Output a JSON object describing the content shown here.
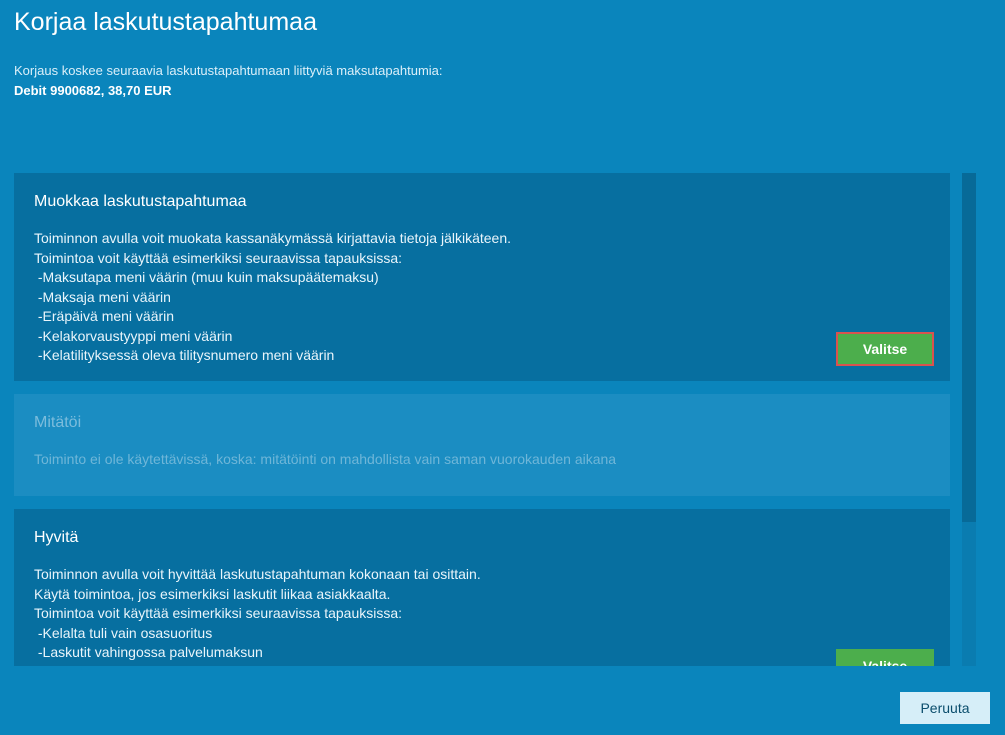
{
  "page": {
    "title": "Korjaa laskutustapahtumaa",
    "intro": "Korjaus koskee seuraavia laskutustapahtumaan liittyviä maksutapahtumia:",
    "debit": "Debit 9900682, 38,70 EUR"
  },
  "cards": [
    {
      "title": "Muokkaa laskutustapahtumaa",
      "lines": [
        "Toiminnon avulla voit muokata kassanäkymässä kirjattavia tietoja jälkikäteen.",
        "Toimintoa voit käyttää esimerkiksi seuraavissa tapauksissa:",
        " -Maksutapa meni väärin (muu kuin maksupäätemaksu)",
        " -Maksaja meni väärin",
        " -Eräpäivä meni väärin",
        " -Kelakorvaustyyppi meni väärin",
        " -Kelatilityksessä oleva tilitysnumero meni väärin"
      ],
      "button": "Valitse"
    },
    {
      "title": "Mitätöi",
      "lines": [
        "Toiminto ei ole käytettävissä, koska: mitätöinti on mahdollista vain saman vuorokauden aikana"
      ],
      "disabled": true
    },
    {
      "title": "Hyvitä",
      "lines": [
        "Toiminnon avulla voit hyvittää laskutustapahtuman kokonaan tai osittain.",
        "Käytä toimintoa, jos esimerkiksi laskutit liikaa asiakkaalta.",
        "Toimintoa voit käyttää esimerkiksi seuraavissa tapauksissa:",
        " -Kelalta tuli vain osasuoritus",
        " -Laskutit vahingossa palvelumaksun"
      ],
      "button": "Valitse"
    }
  ],
  "footer": {
    "cancel": "Peruuta"
  },
  "colors": {
    "background": "#0a85bc",
    "card": "#076fa0",
    "card_disabled": "#1b8dc2",
    "button_green": "#4cae4c",
    "focus_outline": "#d9534f"
  }
}
